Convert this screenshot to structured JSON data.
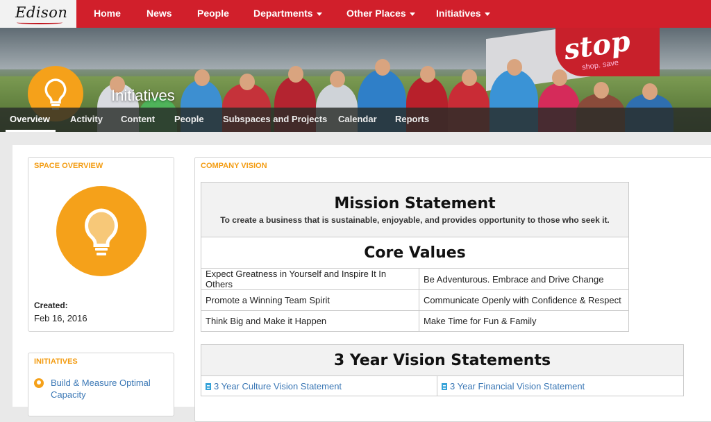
{
  "topnav": {
    "logo": "Edison",
    "items": [
      {
        "label": "Home"
      },
      {
        "label": "News"
      },
      {
        "label": "People"
      },
      {
        "label": "Departments"
      },
      {
        "label": "Other Places"
      },
      {
        "label": "Initiatives"
      }
    ]
  },
  "banner": {
    "space_title": "Initiatives",
    "sign_text": "stop",
    "sign_subtext": "shop. save"
  },
  "subnav": {
    "items": [
      {
        "label": "Overview"
      },
      {
        "label": "Activity"
      },
      {
        "label": "Content"
      },
      {
        "label": "People"
      },
      {
        "label": "Subspaces and Projects"
      },
      {
        "label": "Calendar"
      },
      {
        "label": "Reports"
      }
    ],
    "active": "Overview"
  },
  "space_overview": {
    "title": "SPACE OVERVIEW",
    "created_label": "Created:",
    "created_date": "Feb 16, 2016",
    "avatar_icon": "lightbulb-icon",
    "avatar_color": "#f5a11a"
  },
  "initiatives_panel": {
    "title": "INITIATIVES",
    "items": [
      {
        "label": "Build & Measure Optimal Capacity"
      }
    ]
  },
  "company_vision": {
    "title": "COMPANY VISION",
    "mission_heading": "Mission Statement",
    "mission_text": "To create a business that is sustainable, enjoyable, and provides opportunity to those who seek it.",
    "core_values_heading": "Core Values",
    "core_values": [
      [
        "Expect Greatness in Yourself and Inspire It In Others",
        "Be Adventurous. Embrace and Drive Change"
      ],
      [
        "Promote a Winning Team Spirit",
        "Communicate Openly with Confidence & Respect"
      ],
      [
        "Think Big and Make it Happen",
        "Make Time for Fun & Family"
      ]
    ],
    "vision_heading": "3 Year Vision Statements",
    "vision_links": [
      {
        "label": "3 Year Culture Vision Statement"
      },
      {
        "label": "3 Year Financial Vision Statement"
      }
    ]
  },
  "colors": {
    "brand_red": "#d11f2b",
    "accent_orange": "#f39c12",
    "link_blue": "#3a77b5"
  }
}
